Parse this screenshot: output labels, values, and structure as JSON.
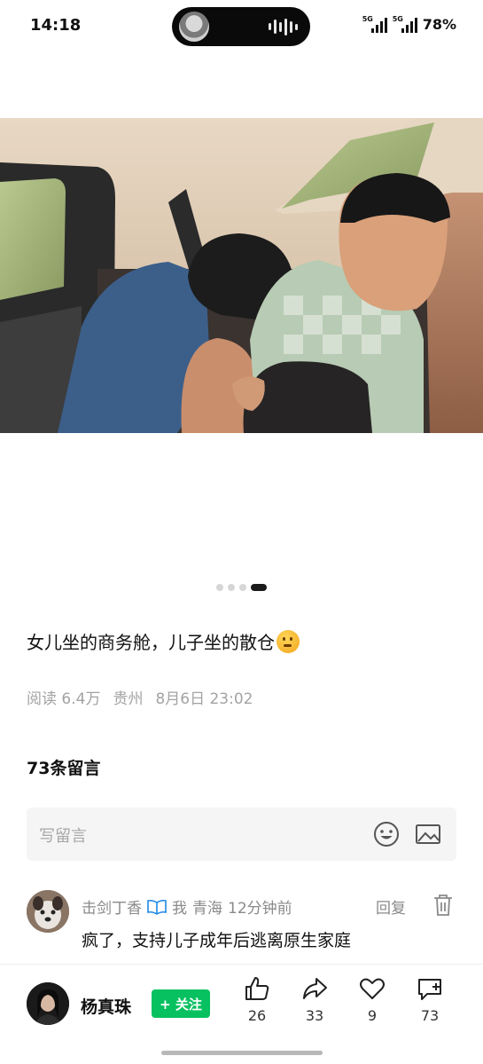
{
  "status_bar": {
    "time": "14:18",
    "signal_1_label": "5G",
    "signal_2_label": "5G",
    "battery": "78%"
  },
  "post": {
    "image_page_count": 4,
    "image_page_active": 4,
    "text": "女儿坐的商务舱，儿子坐的散仓",
    "emoji_icon": "thinking-face-emoji",
    "meta": {
      "reads": "阅读 6.4万",
      "location": "贵州",
      "datetime": "8月6日 23:02"
    }
  },
  "comments": {
    "title": "73条留言",
    "input_placeholder": "写留言",
    "items": [
      {
        "author": "击剑丁香",
        "badge_icon": "open-book-icon",
        "me_label": "我",
        "location": "青海",
        "time": "12分钟前",
        "reply_label": "回复",
        "text": "疯了，支持儿子成年后逃离原生家庭"
      }
    ]
  },
  "author_bar": {
    "name": "杨真珠",
    "follow_label": "+ 关注",
    "like_count": "26",
    "share_count": "33",
    "favorite_count": "9",
    "comment_count": "73"
  },
  "colors": {
    "accent_green": "#07c160",
    "meta_gray": "#a3a3a3"
  }
}
